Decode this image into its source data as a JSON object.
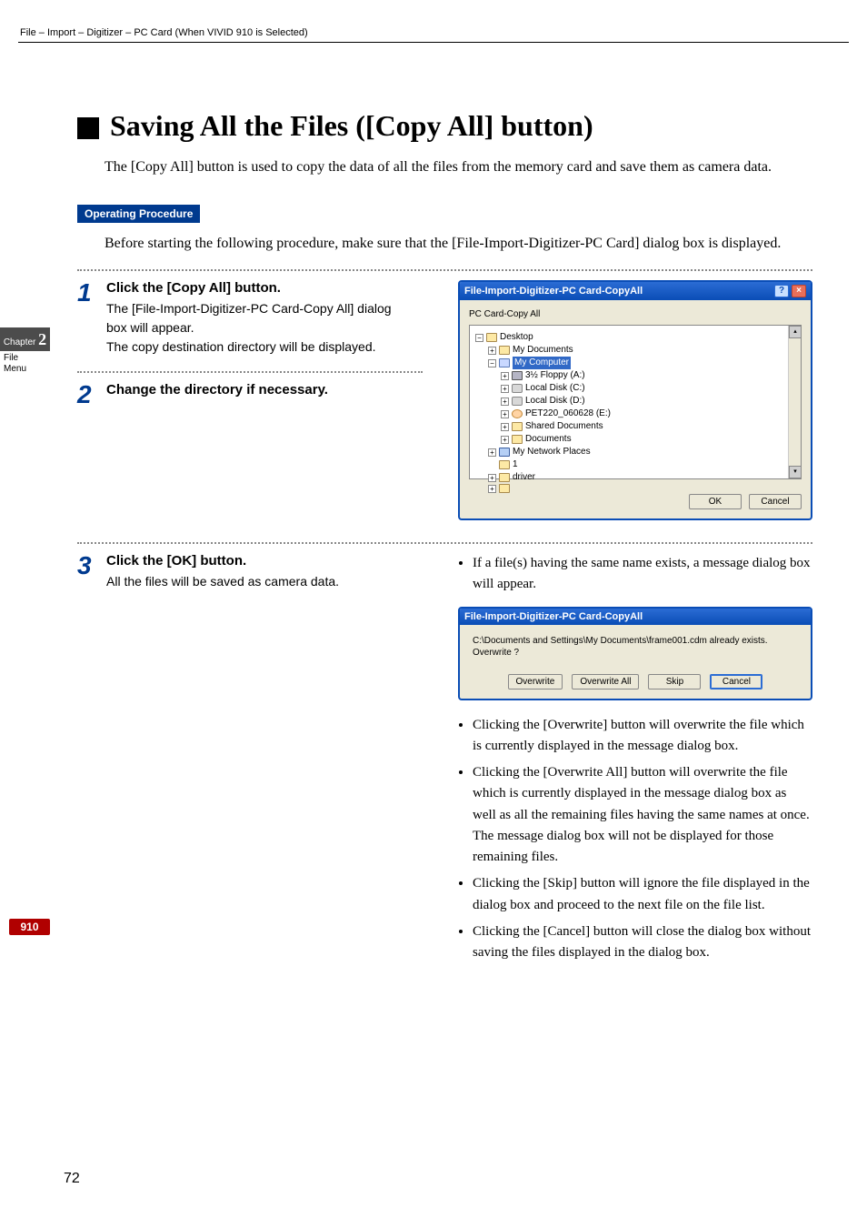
{
  "header": "File – Import – Digitizer – PC Card (When VIVID 910 is Selected)",
  "sidebar": {
    "chapter_label": "Chapter",
    "chapter_num": "2",
    "file_tab": "File",
    "menu_tab": "Menu"
  },
  "badge": "910",
  "title": "Saving All the Files ([Copy All] button)",
  "intro": "The [Copy All] button is used to copy the data of all the files from the memory card and save them as camera data.",
  "op_proc": "Operating Procedure",
  "before": "Before starting the following procedure, make sure that the [File-Import-Digitizer-PC Card] dialog box is displayed.",
  "steps": {
    "s1": {
      "num": "1",
      "head": "Click the [Copy All] button.",
      "body": "The [File-Import-Digitizer-PC Card-Copy All] dialog box will appear.\nThe copy destination directory will be displayed."
    },
    "s2": {
      "num": "2",
      "head": "Change the directory if necessary."
    },
    "s3": {
      "num": "3",
      "head": "Click the [OK] button.",
      "body": "All the files will be saved as camera data."
    }
  },
  "dlg1": {
    "title": "File-Import-Digitizer-PC Card-CopyAll",
    "subtitle": "PC Card-Copy All",
    "help": "?",
    "close": "×",
    "tree": {
      "desktop": "Desktop",
      "mydocs": "My Documents",
      "mycomp": "My Computer",
      "floppy": "3½ Floppy (A:)",
      "c": "Local Disk (C:)",
      "d": "Local Disk (D:)",
      "e": "PET220_060628 (E:)",
      "shared": "Shared Documents",
      "docs": "Documents",
      "net": "My Network Places",
      "one": "1",
      "driver": "driver"
    },
    "ok": "OK",
    "cancel": "Cancel"
  },
  "note1": "If a file(s) having the same name exists, a message dialog box will appear.",
  "dlg2": {
    "title": "File-Import-Digitizer-PC Card-CopyAll",
    "msg": "C:\\Documents and Settings\\My Documents\\frame001.cdm already exists.",
    "q": "Overwrite ?",
    "b1": "Overwrite",
    "b2": "Overwrite All",
    "b3": "Skip",
    "b4": "Cancel"
  },
  "bullets": {
    "b1": "Clicking the [Overwrite] button will overwrite the file which is currently displayed in the message dialog box.",
    "b2": "Clicking the [Overwrite All] button will overwrite the file which is currently displayed in the message dialog box as well as all the remaining files having the same names at once. The message dialog box will not be displayed for those remaining files.",
    "b3": "Clicking the [Skip] button will ignore the file displayed in the dialog box and proceed to the next file on the file list.",
    "b4": "Clicking the [Cancel] button will close the dialog box without saving the files displayed in the dialog box."
  },
  "page_num": "72"
}
